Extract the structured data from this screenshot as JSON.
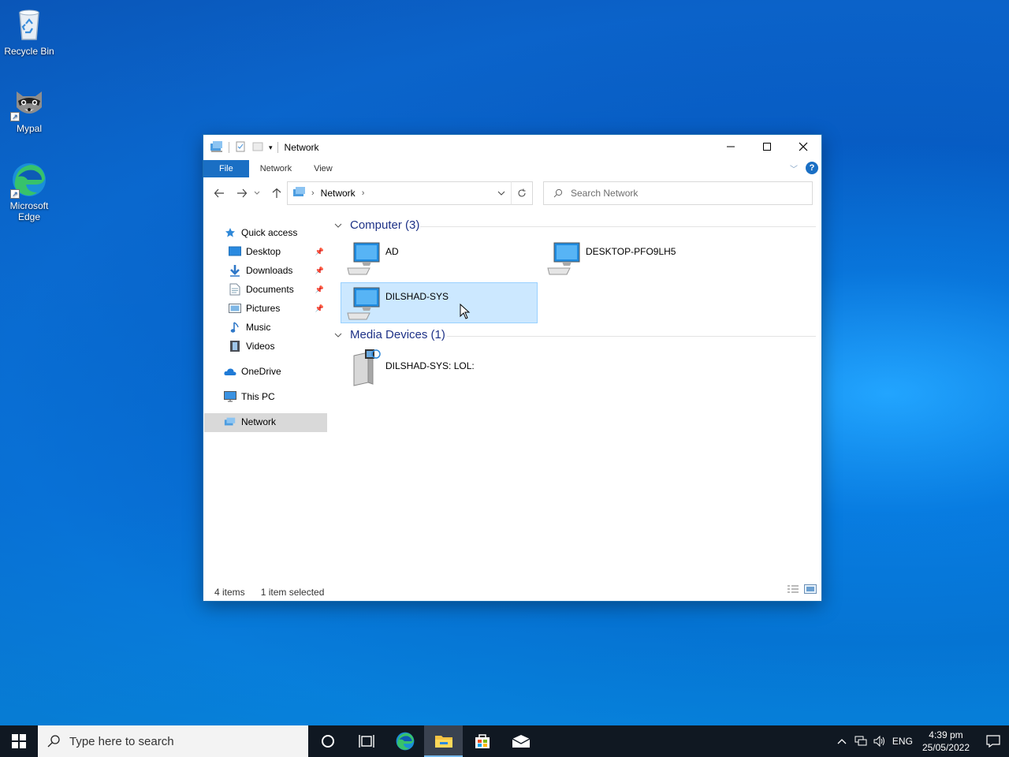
{
  "colors": {
    "accent": "#1a6fc4",
    "selection_bg": "#cce8ff",
    "selection_border": "#99d1ff",
    "group_header": "#1e3287",
    "taskbar_bg": "#101822"
  },
  "desktop": {
    "icons": [
      {
        "label": "Recycle Bin",
        "icon": "recycle-bin-icon"
      },
      {
        "label": "Mypal",
        "icon": "mypal-raccoon-icon"
      },
      {
        "label": "Microsoft Edge",
        "icon": "edge-icon"
      }
    ]
  },
  "window": {
    "title": "Network",
    "ribbon_tabs": [
      "File",
      "Network",
      "View"
    ],
    "address": {
      "crumb": "Network"
    },
    "search_placeholder": "Search Network",
    "nav_pane": {
      "quick_access": "Quick access",
      "items": [
        {
          "label": "Desktop",
          "pinned": true
        },
        {
          "label": "Downloads",
          "pinned": true
        },
        {
          "label": "Documents",
          "pinned": true
        },
        {
          "label": "Pictures",
          "pinned": true
        },
        {
          "label": "Music",
          "pinned": false
        },
        {
          "label": "Videos",
          "pinned": false
        }
      ],
      "onedrive": "OneDrive",
      "this_pc": "This PC",
      "network": "Network",
      "selected": "Network"
    },
    "groups": [
      {
        "header": "Computer (3)",
        "items": [
          {
            "label": "AD",
            "icon": "computer-icon",
            "selected": false
          },
          {
            "label": "DESKTOP-PFO9LH5",
            "icon": "computer-icon",
            "selected": false
          },
          {
            "label": "DILSHAD-SYS",
            "icon": "computer-icon",
            "selected": true
          }
        ]
      },
      {
        "header": "Media Devices (1)",
        "items": [
          {
            "label": "DILSHAD-SYS: LOL:",
            "icon": "media-server-icon",
            "selected": false
          }
        ]
      }
    ],
    "status": {
      "item_count": "4 items",
      "selection": "1 item selected"
    }
  },
  "taskbar": {
    "search_placeholder": "Type here to search",
    "apps": [
      "cortana-icon",
      "task-view-icon",
      "edge-icon",
      "file-explorer-icon",
      "store-icon",
      "mail-icon"
    ],
    "active_app": "file-explorer-icon",
    "tray": {
      "language": "ENG",
      "time": "4:39 pm",
      "date": "25/05/2022"
    }
  }
}
